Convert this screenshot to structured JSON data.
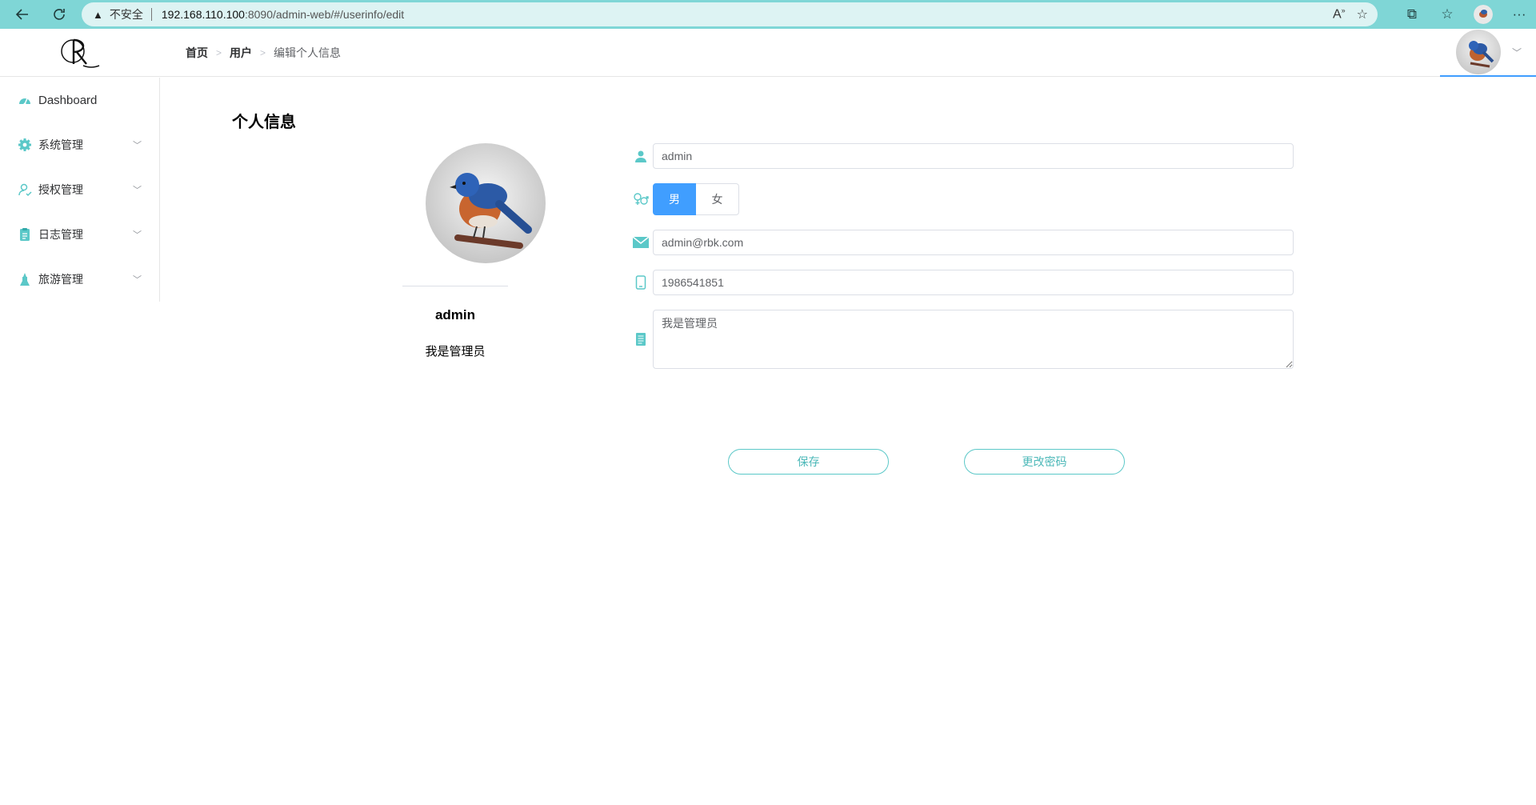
{
  "browser": {
    "insecure_label": "不安全",
    "url_host": "192.168.110.100",
    "url_path": ":8090/admin-web/#/userinfo/edit"
  },
  "header": {
    "breadcrumb": [
      "首页",
      "用户",
      "编辑个人信息"
    ]
  },
  "sidebar": {
    "items": [
      {
        "label": "Dashboard",
        "icon": "dashboard-icon",
        "has_submenu": false
      },
      {
        "label": "系统管理",
        "icon": "gear-icon",
        "has_submenu": true
      },
      {
        "label": "授权管理",
        "icon": "user-check-icon",
        "has_submenu": true
      },
      {
        "label": "日志管理",
        "icon": "clipboard-icon",
        "has_submenu": true
      },
      {
        "label": "旅游管理",
        "icon": "tourism-icon",
        "has_submenu": true
      }
    ]
  },
  "main": {
    "title": "个人信息",
    "profile": {
      "name": "admin",
      "description": "我是管理员"
    },
    "form": {
      "username": "admin",
      "gender_options": [
        "男",
        "女"
      ],
      "gender_selected": "男",
      "email": "admin@rbk.com",
      "phone": "1986541851",
      "intro": "我是管理员"
    },
    "buttons": {
      "save": "保存",
      "change_password": "更改密码"
    }
  },
  "colors": {
    "accent": "#5bc8c8",
    "primary": "#409eff",
    "browser_bar": "#7fd6d6"
  }
}
